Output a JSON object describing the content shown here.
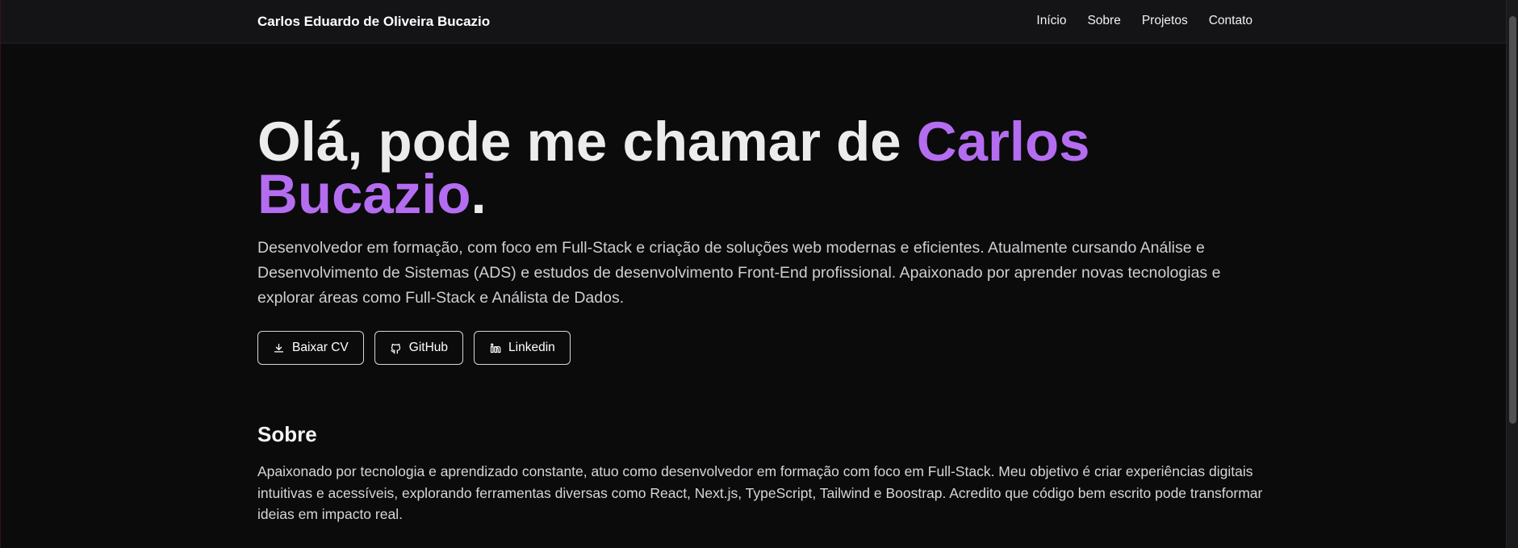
{
  "header": {
    "brand": "Carlos Eduardo de Oliveira Bucazio",
    "nav": [
      {
        "label": "Início"
      },
      {
        "label": "Sobre"
      },
      {
        "label": "Projetos"
      },
      {
        "label": "Contato"
      }
    ]
  },
  "hero": {
    "title_prefix": "Olá, pode me chamar de ",
    "title_name": "Carlos Bucazio",
    "title_suffix": ".",
    "description": "Desenvolvedor em formação, com foco em Full-Stack e criação de soluções web modernas e eficientes. Atualmente cursando Análise e Desenvolvimento de Sistemas (ADS) e estudos de desenvolvimento Front-End profissional. Apaixonado por aprender novas tecnologias e explorar áreas como Full-Stack e Análista de Dados.",
    "buttons": [
      {
        "label": "Baixar CV",
        "icon": "download-icon"
      },
      {
        "label": "GitHub",
        "icon": "github-icon"
      },
      {
        "label": "Linkedin",
        "icon": "linkedin-icon"
      }
    ]
  },
  "about": {
    "title": "Sobre",
    "text": "Apaixonado por tecnologia e aprendizado constante, atuo como desenvolvedor em formação com foco em Full-Stack. Meu objetivo é criar experiências digitais intuitivas e acessíveis, explorando ferramentas diversas como React, Next.js, TypeScript, Tailwind e Boostrap. Acredito que código bem escrito pode transformar ideias em impacto real."
  },
  "colors": {
    "background": "#0b0b0c",
    "header": "#141416",
    "accent": "#b46df0",
    "text": "#ececec"
  }
}
